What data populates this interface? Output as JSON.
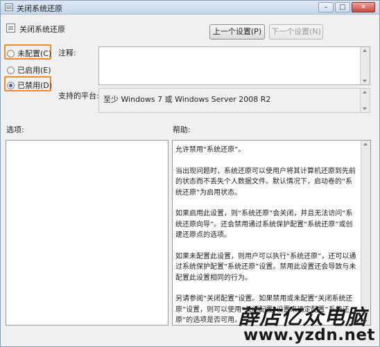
{
  "window": {
    "title": "关闭系统还原",
    "minimize": "–",
    "maximize": "□",
    "close": "✕"
  },
  "header": {
    "title": "关闭系统还原",
    "prev_label": "上一个设置(P)",
    "next_label": "下一个设置(N)"
  },
  "options": {
    "not_configured": "未配置(C)",
    "enabled": "已启用(E)",
    "disabled": "已禁用(D)",
    "selected": "disabled"
  },
  "fields": {
    "comment_label": "注释:",
    "comment_value": "",
    "platform_label": "支持的平台:",
    "platform_value": "至少 Windows 7 或 Windows Server 2008 R2",
    "options_label": "选项:",
    "help_label": "帮助:"
  },
  "help": {
    "p1": "允许禁用“系统还原”。",
    "p2": "当出现问题时，系统还原可以使用户将其计算机还原到先前的状态而不丢失个人数据文件。默认情况下，启动卷的“系统还原”为启用状态。",
    "p3": "如果启用此设置，则“系统还原”会关闭，并且无法访问“系统还原向导”。还会禁用通过系统保护配置“系统还原”或创建还原点的选项。",
    "p4": "如果未配置此设置，则用户可以执行“系统还原”，还可以通过系统保护配置“系统还原”设置。禁用此设置还会导致与未配置此设置相同的行为。",
    "p5": "另请参阅“关闭配置”设置。如果禁用或未配置“关闭系统还原”设置，则可以使用“关闭配置”设置来确定配置“系统还原”的选项是否可用。"
  },
  "watermark": {
    "text": "薛店亿众电脑",
    "url": "www.yzdn.net"
  },
  "colors": {
    "highlight": "#ec8a2c",
    "radio_dot": "#2b66c4"
  }
}
